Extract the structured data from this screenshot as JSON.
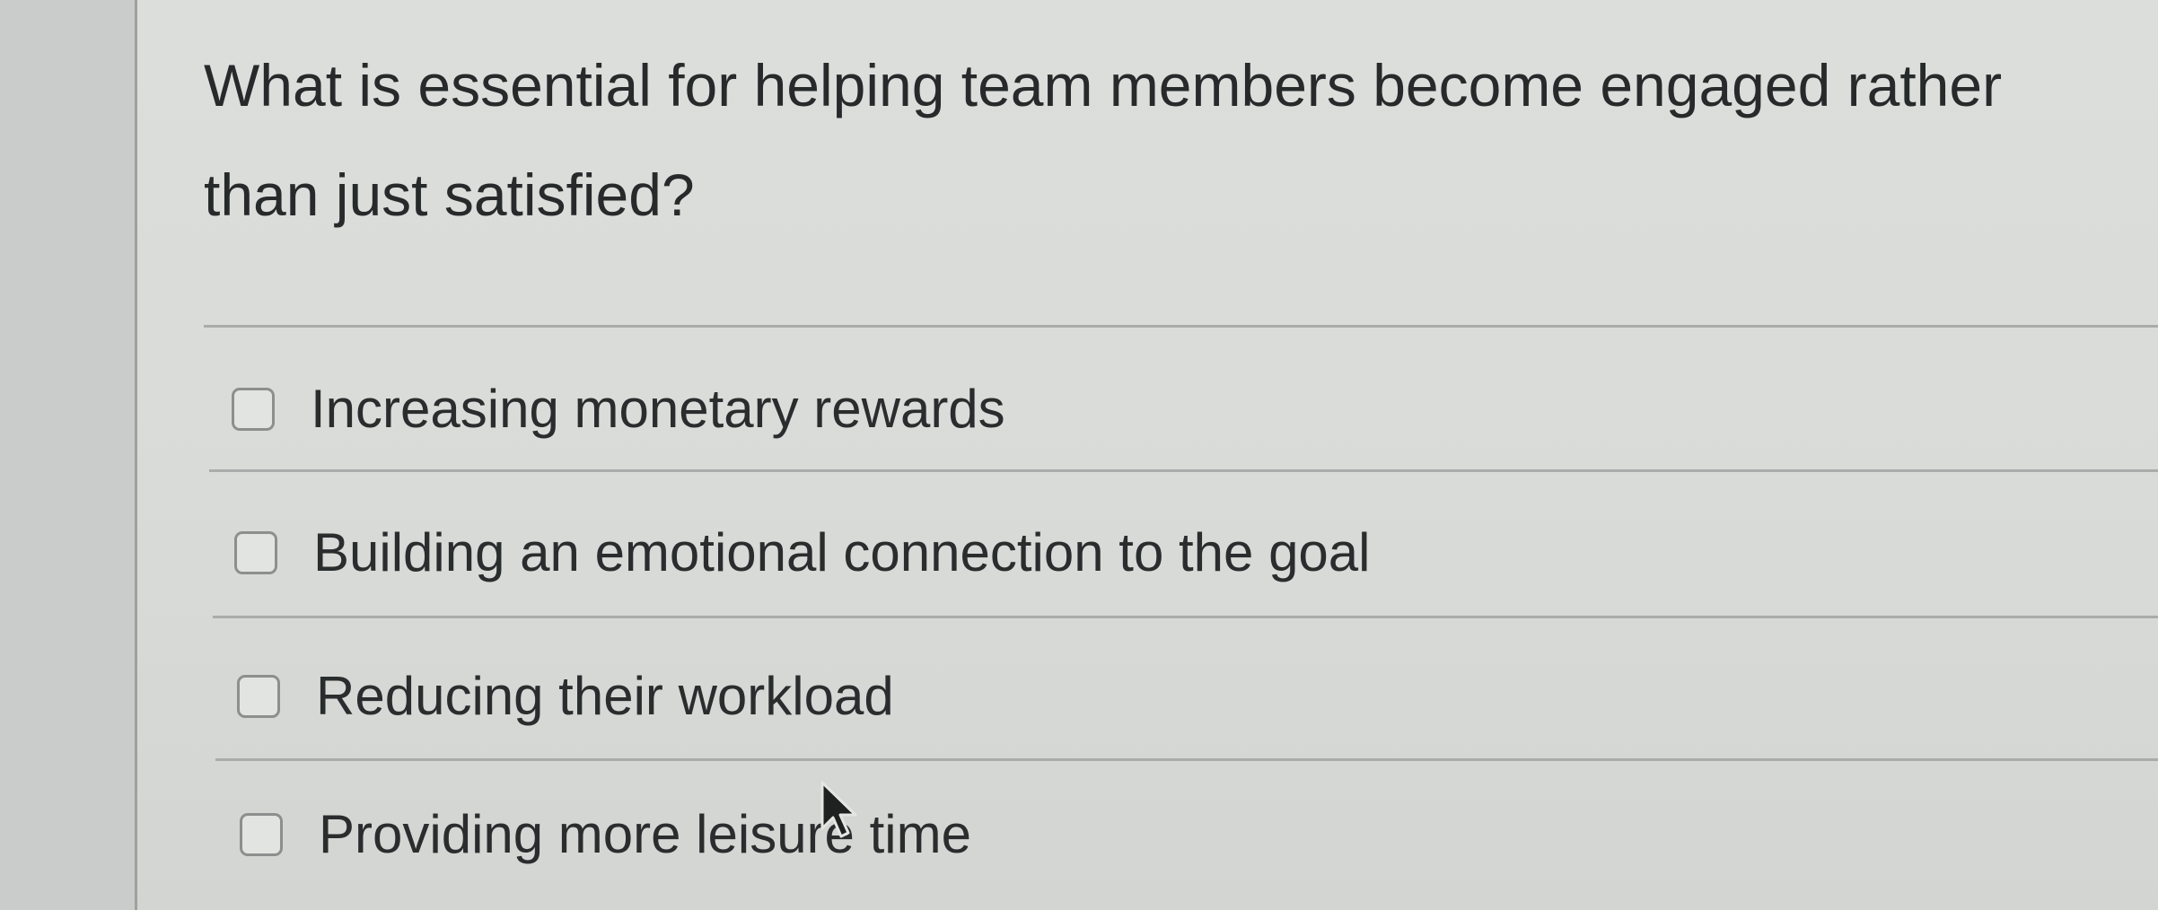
{
  "question": {
    "text": "What is essential for helping team members become engaged rather than just satisfied?"
  },
  "options": [
    {
      "label": "Increasing monetary rewards",
      "checked": false
    },
    {
      "label": "Building an emotional connection to the goal",
      "checked": false
    },
    {
      "label": "Reducing their workload",
      "checked": false
    },
    {
      "label": "Providing more leisure time",
      "checked": false
    }
  ],
  "cursor": {
    "icon": "arrow-pointer-icon"
  },
  "colors": {
    "background": "#d9dbd9",
    "text": "#272a2a",
    "divider": "#a9acaa",
    "checkbox_border": "#8c8f8d"
  }
}
